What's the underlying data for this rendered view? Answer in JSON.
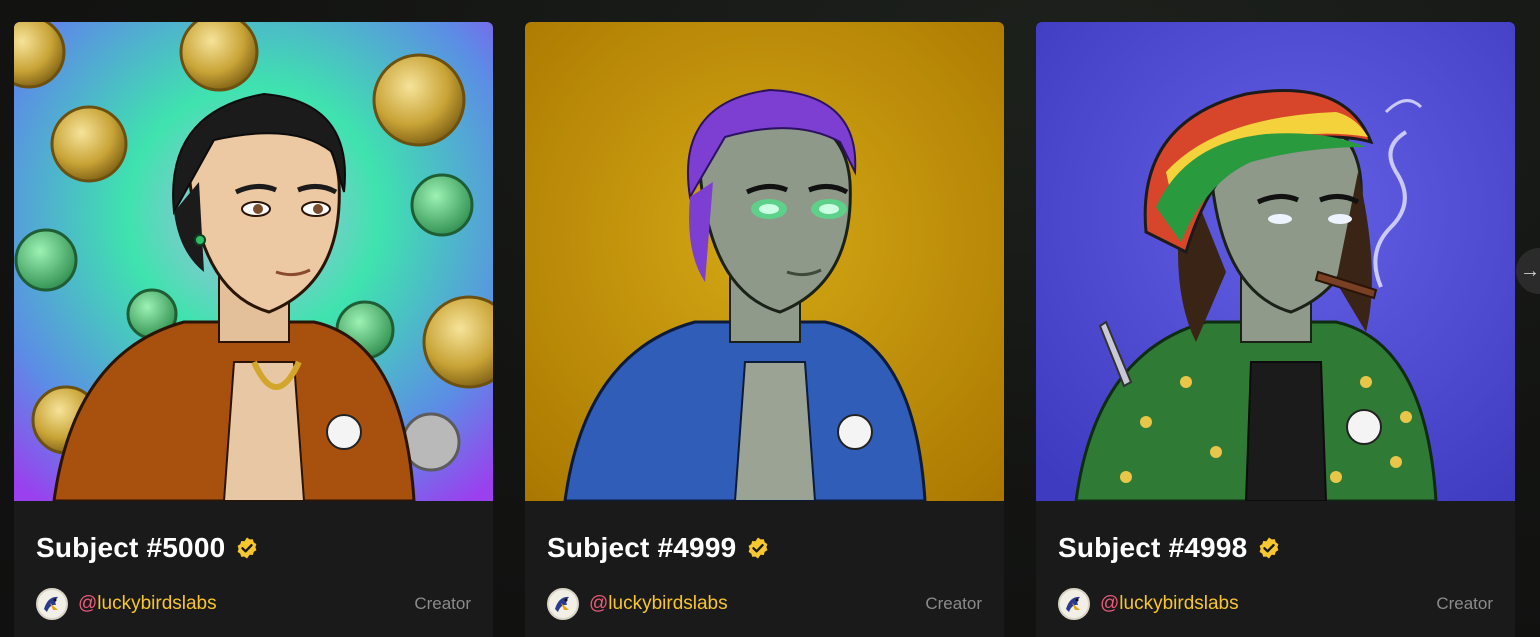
{
  "cards": [
    {
      "title": "Subject #5000",
      "creator_handle": "luckybirdslabs",
      "creator_role": "Creator",
      "background_colors": [
        "#32e0a6",
        "#8f47e8"
      ],
      "jacket_color": "#a8510f"
    },
    {
      "title": "Subject #4999",
      "creator_handle": "luckybirdslabs",
      "creator_role": "Creator",
      "background_colors": [
        "#c99a0c",
        "#b37e00"
      ],
      "jacket_color": "#2f5db8"
    },
    {
      "title": "Subject #4998",
      "creator_handle": "luckybirdslabs",
      "creator_role": "Creator",
      "background_colors": [
        "#5a56de",
        "#4340c8"
      ],
      "jacket_color": "#2f7a34"
    }
  ],
  "accent_colors": {
    "verified": "#f6c72f",
    "handle": "#f7c52e",
    "at_symbol": "#ea5a7a",
    "role": "#8b8b8b"
  },
  "icons": {
    "verified": "verified-badge-icon",
    "next": "arrow-right-icon"
  },
  "next_arrow_glyph": "→"
}
